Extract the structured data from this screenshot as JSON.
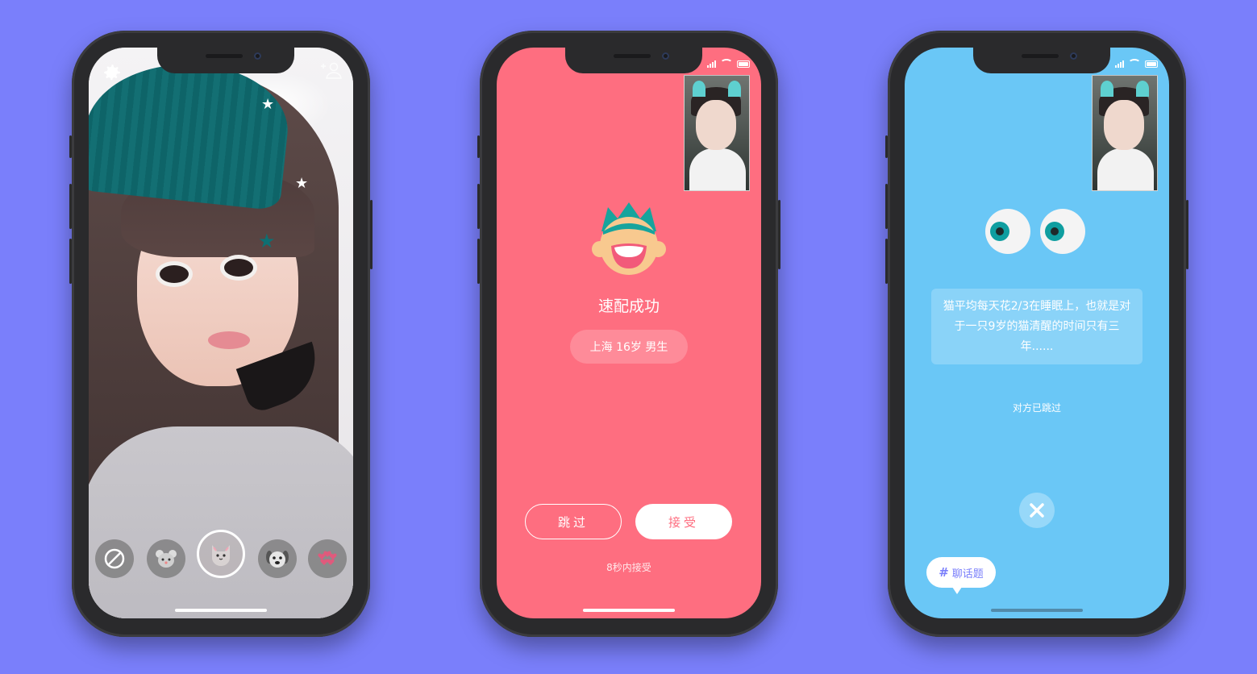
{
  "phone1": {
    "filters": [
      "none",
      "mouse",
      "cat",
      "dog",
      "heart"
    ]
  },
  "phone2": {
    "title": "速配成功",
    "info": "上海 16岁 男生",
    "skip_label": "跳过",
    "accept_label": "接受",
    "countdown": "8秒内接受",
    "accent_color": "#fe6e80"
  },
  "phone3": {
    "fact": "猫平均每天花2/3在睡眠上，也就是对于一只9岁的猫清醒的时间只有三年......",
    "status": "对方已跳过",
    "topic_label": "聊话题",
    "topic_hash": "#",
    "accent_color": "#6ac7f6"
  },
  "background_color": "#7a7ffb"
}
